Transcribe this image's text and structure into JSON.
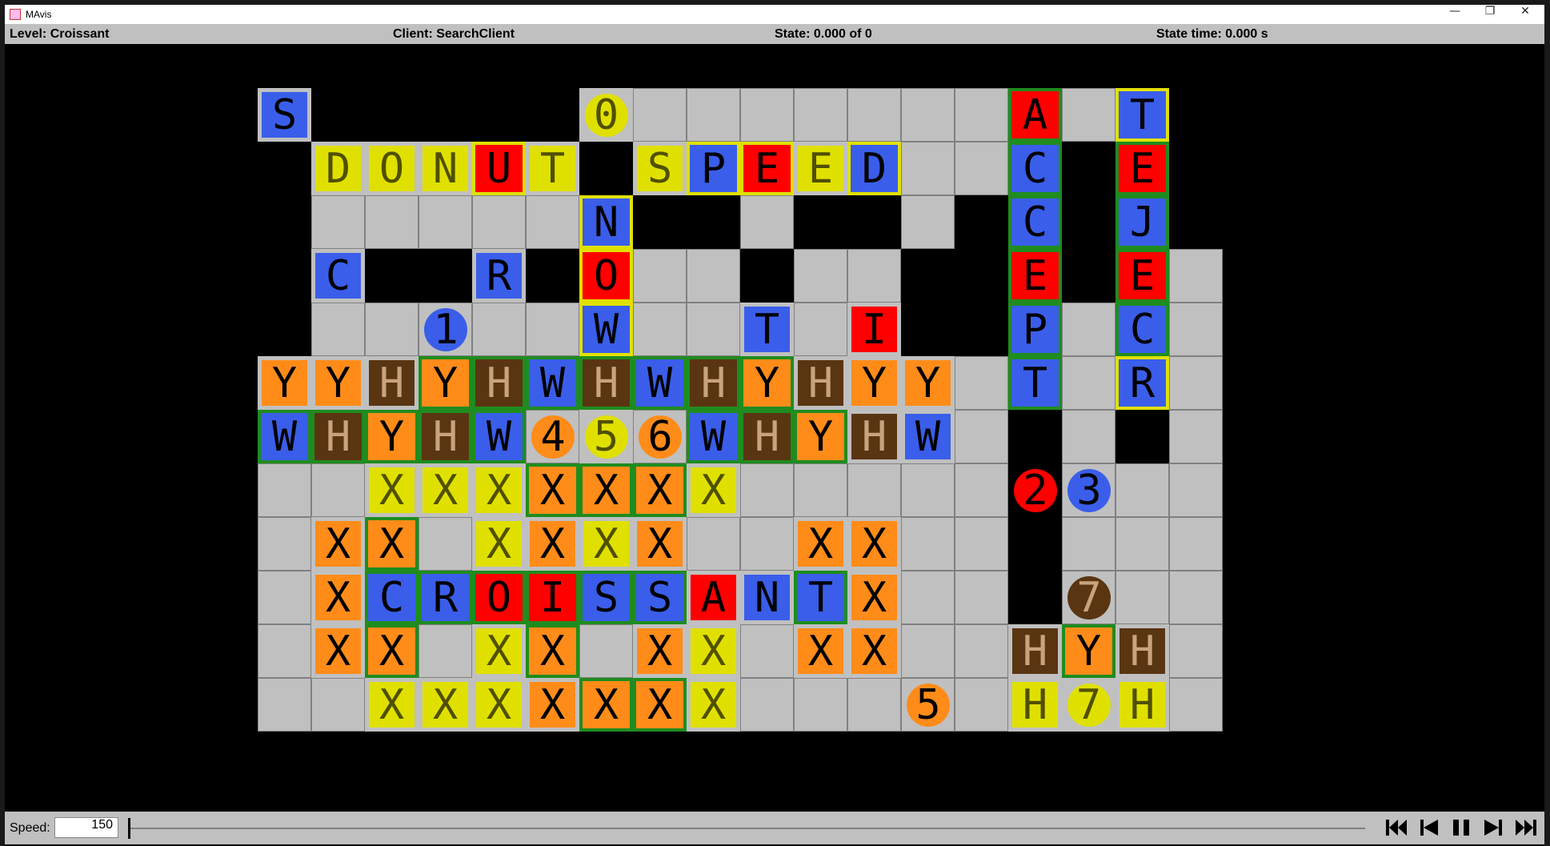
{
  "window": {
    "title": "MAvis",
    "minimize_icon": "minimize-icon",
    "maximize_icon": "restore-icon",
    "close_icon": "close-icon"
  },
  "status": {
    "level": "Level: Croissant",
    "client": "Client: SearchClient",
    "state": "State: 0.000 of 0",
    "state_time": "State time: 0.000 s"
  },
  "colors": {
    "yellow": "#e0e000",
    "yellow_text": "#505000",
    "red": "#ff0000",
    "blue": "#3a5eea",
    "orange": "#ff8c19",
    "brown": "#5a3512",
    "brown_text": "#c9a27e",
    "green": "#1f8c1f",
    "floor": "#c0c0c0",
    "wall": "#000000"
  },
  "board": {
    "floor_rows": [
      "#######..........#",
      "#.....#....#...#.#",
      "#.....###.##.#.#.#",
      "#.##.##..#..##.##.",
      "#..........####.#.",
      "..............#.#.",
      "..............#.#.",
      "..............#...",
      "..............#...",
      "..............#...",
      "..............#...",
      "..............#..."
    ],
    "goals": [
      {
        "letter": "0",
        "row": 0,
        "col": 6,
        "color": "yellow"
      },
      {
        "letter": "5",
        "row": 6,
        "col": 6,
        "color": "yellow"
      },
      {
        "letter": "7",
        "row": 11,
        "col": 15,
        "color": "yellow"
      }
    ],
    "boxes": [
      {
        "letter": "S",
        "row": 0,
        "col": 0,
        "color": "blue"
      },
      {
        "letter": "D",
        "row": 1,
        "col": 1,
        "color": "yellow"
      },
      {
        "letter": "O",
        "row": 1,
        "col": 2,
        "color": "yellow"
      },
      {
        "letter": "N",
        "row": 1,
        "col": 3,
        "color": "yellow"
      },
      {
        "letter": "U",
        "row": 1,
        "col": 4,
        "color": "red",
        "on_goal": "yellow"
      },
      {
        "letter": "T",
        "row": 1,
        "col": 5,
        "color": "yellow"
      },
      {
        "letter": "S",
        "row": 1,
        "col": 7,
        "color": "yellow"
      },
      {
        "letter": "P",
        "row": 1,
        "col": 8,
        "color": "blue",
        "on_goal": "yellow"
      },
      {
        "letter": "E",
        "row": 1,
        "col": 9,
        "color": "red",
        "on_goal": "yellow"
      },
      {
        "letter": "E",
        "row": 1,
        "col": 10,
        "color": "yellow"
      },
      {
        "letter": "D",
        "row": 1,
        "col": 11,
        "color": "blue",
        "on_goal": "yellow"
      },
      {
        "letter": "N",
        "row": 2,
        "col": 6,
        "color": "blue",
        "on_goal": "yellow"
      },
      {
        "letter": "C",
        "row": 3,
        "col": 1,
        "color": "blue"
      },
      {
        "letter": "R",
        "row": 3,
        "col": 4,
        "color": "blue"
      },
      {
        "letter": "O",
        "row": 3,
        "col": 6,
        "color": "red",
        "on_goal": "yellow"
      },
      {
        "letter": "W",
        "row": 4,
        "col": 6,
        "color": "blue",
        "on_goal": "yellow"
      },
      {
        "letter": "T",
        "row": 4,
        "col": 9,
        "color": "blue"
      },
      {
        "letter": "I",
        "row": 4,
        "col": 11,
        "color": "red"
      },
      {
        "letter": "Y",
        "row": 5,
        "col": 0,
        "color": "orange"
      },
      {
        "letter": "Y",
        "row": 5,
        "col": 1,
        "color": "orange"
      },
      {
        "letter": "H",
        "row": 5,
        "col": 2,
        "color": "brown"
      },
      {
        "letter": "Y",
        "row": 5,
        "col": 3,
        "color": "orange",
        "on_goal": "green"
      },
      {
        "letter": "H",
        "row": 5,
        "col": 4,
        "color": "brown",
        "on_goal": "green"
      },
      {
        "letter": "W",
        "row": 5,
        "col": 5,
        "color": "blue",
        "on_goal": "green"
      },
      {
        "letter": "H",
        "row": 5,
        "col": 6,
        "color": "brown",
        "on_goal": "green"
      },
      {
        "letter": "W",
        "row": 5,
        "col": 7,
        "color": "blue",
        "on_goal": "green"
      },
      {
        "letter": "H",
        "row": 5,
        "col": 8,
        "color": "brown",
        "on_goal": "green"
      },
      {
        "letter": "Y",
        "row": 5,
        "col": 9,
        "color": "orange",
        "on_goal": "green"
      },
      {
        "letter": "H",
        "row": 5,
        "col": 10,
        "color": "brown"
      },
      {
        "letter": "Y",
        "row": 5,
        "col": 11,
        "color": "orange"
      },
      {
        "letter": "Y",
        "row": 5,
        "col": 12,
        "color": "orange"
      },
      {
        "letter": "W",
        "row": 6,
        "col": 0,
        "color": "blue",
        "on_goal": "green"
      },
      {
        "letter": "H",
        "row": 6,
        "col": 1,
        "color": "brown",
        "on_goal": "green"
      },
      {
        "letter": "Y",
        "row": 6,
        "col": 2,
        "color": "orange",
        "on_goal": "green"
      },
      {
        "letter": "H",
        "row": 6,
        "col": 3,
        "color": "brown",
        "on_goal": "green"
      },
      {
        "letter": "W",
        "row": 6,
        "col": 4,
        "color": "blue",
        "on_goal": "green"
      },
      {
        "letter": "W",
        "row": 6,
        "col": 8,
        "color": "blue",
        "on_goal": "green"
      },
      {
        "letter": "H",
        "row": 6,
        "col": 9,
        "color": "brown",
        "on_goal": "green"
      },
      {
        "letter": "Y",
        "row": 6,
        "col": 10,
        "color": "orange",
        "on_goal": "green"
      },
      {
        "letter": "H",
        "row": 6,
        "col": 11,
        "color": "brown"
      },
      {
        "letter": "W",
        "row": 6,
        "col": 12,
        "color": "blue"
      },
      {
        "letter": "X",
        "row": 7,
        "col": 2,
        "color": "yellow"
      },
      {
        "letter": "X",
        "row": 7,
        "col": 3,
        "color": "yellow"
      },
      {
        "letter": "X",
        "row": 7,
        "col": 4,
        "color": "yellow"
      },
      {
        "letter": "X",
        "row": 7,
        "col": 5,
        "color": "orange",
        "on_goal": "green"
      },
      {
        "letter": "X",
        "row": 7,
        "col": 6,
        "color": "orange",
        "on_goal": "green"
      },
      {
        "letter": "X",
        "row": 7,
        "col": 7,
        "color": "orange",
        "on_goal": "green"
      },
      {
        "letter": "X",
        "row": 7,
        "col": 8,
        "color": "yellow"
      },
      {
        "letter": "X",
        "row": 8,
        "col": 1,
        "color": "orange"
      },
      {
        "letter": "X",
        "row": 8,
        "col": 2,
        "color": "orange",
        "on_goal": "green"
      },
      {
        "letter": "X",
        "row": 8,
        "col": 4,
        "color": "yellow"
      },
      {
        "letter": "X",
        "row": 8,
        "col": 5,
        "color": "orange"
      },
      {
        "letter": "X",
        "row": 8,
        "col": 6,
        "color": "yellow"
      },
      {
        "letter": "X",
        "row": 8,
        "col": 7,
        "color": "orange"
      },
      {
        "letter": "X",
        "row": 8,
        "col": 10,
        "color": "orange"
      },
      {
        "letter": "X",
        "row": 8,
        "col": 11,
        "color": "orange"
      },
      {
        "letter": "X",
        "row": 9,
        "col": 1,
        "color": "orange"
      },
      {
        "letter": "C",
        "row": 9,
        "col": 2,
        "color": "blue",
        "on_goal": "green"
      },
      {
        "letter": "R",
        "row": 9,
        "col": 3,
        "color": "blue",
        "on_goal": "green"
      },
      {
        "letter": "O",
        "row": 9,
        "col": 4,
        "color": "red",
        "on_goal": "green"
      },
      {
        "letter": "I",
        "row": 9,
        "col": 5,
        "color": "red",
        "on_goal": "green"
      },
      {
        "letter": "S",
        "row": 9,
        "col": 6,
        "color": "blue",
        "on_goal": "green"
      },
      {
        "letter": "S",
        "row": 9,
        "col": 7,
        "color": "blue",
        "on_goal": "green"
      },
      {
        "letter": "A",
        "row": 9,
        "col": 8,
        "color": "red"
      },
      {
        "letter": "N",
        "row": 9,
        "col": 9,
        "color": "blue"
      },
      {
        "letter": "T",
        "row": 9,
        "col": 10,
        "color": "blue",
        "on_goal": "green"
      },
      {
        "letter": "X",
        "row": 9,
        "col": 11,
        "color": "orange"
      },
      {
        "letter": "X",
        "row": 10,
        "col": 1,
        "color": "orange"
      },
      {
        "letter": "X",
        "row": 10,
        "col": 2,
        "color": "orange",
        "on_goal": "green"
      },
      {
        "letter": "X",
        "row": 10,
        "col": 4,
        "color": "yellow"
      },
      {
        "letter": "X",
        "row": 10,
        "col": 5,
        "color": "orange",
        "on_goal": "green"
      },
      {
        "letter": "X",
        "row": 10,
        "col": 7,
        "color": "orange"
      },
      {
        "letter": "X",
        "row": 10,
        "col": 8,
        "color": "yellow"
      },
      {
        "letter": "X",
        "row": 10,
        "col": 10,
        "color": "orange"
      },
      {
        "letter": "X",
        "row": 10,
        "col": 11,
        "color": "orange"
      },
      {
        "letter": "X",
        "row": 11,
        "col": 2,
        "color": "yellow"
      },
      {
        "letter": "X",
        "row": 11,
        "col": 3,
        "color": "yellow"
      },
      {
        "letter": "X",
        "row": 11,
        "col": 4,
        "color": "yellow"
      },
      {
        "letter": "X",
        "row": 11,
        "col": 5,
        "color": "orange"
      },
      {
        "letter": "X",
        "row": 11,
        "col": 6,
        "color": "orange",
        "on_goal": "green"
      },
      {
        "letter": "X",
        "row": 11,
        "col": 7,
        "color": "orange",
        "on_goal": "green"
      },
      {
        "letter": "X",
        "row": 11,
        "col": 8,
        "color": "yellow"
      },
      {
        "letter": "A",
        "row": 0,
        "col": 14,
        "color": "red",
        "on_goal": "green"
      },
      {
        "letter": "C",
        "row": 1,
        "col": 14,
        "color": "blue",
        "on_goal": "green"
      },
      {
        "letter": "C",
        "row": 2,
        "col": 14,
        "color": "blue",
        "on_goal": "green"
      },
      {
        "letter": "E",
        "row": 3,
        "col": 14,
        "color": "red",
        "on_goal": "green"
      },
      {
        "letter": "P",
        "row": 4,
        "col": 14,
        "color": "blue",
        "on_goal": "green"
      },
      {
        "letter": "T",
        "row": 5,
        "col": 14,
        "color": "blue",
        "on_goal": "green"
      },
      {
        "letter": "T",
        "row": 0,
        "col": 16,
        "color": "blue",
        "on_goal": "yellow"
      },
      {
        "letter": "E",
        "row": 1,
        "col": 16,
        "color": "red",
        "on_goal": "green"
      },
      {
        "letter": "J",
        "row": 2,
        "col": 16,
        "color": "blue",
        "on_goal": "green"
      },
      {
        "letter": "E",
        "row": 3,
        "col": 16,
        "color": "red",
        "on_goal": "green"
      },
      {
        "letter": "C",
        "row": 4,
        "col": 16,
        "color": "blue",
        "on_goal": "green"
      },
      {
        "letter": "R",
        "row": 5,
        "col": 16,
        "color": "blue",
        "on_goal": "yellow"
      },
      {
        "letter": "H",
        "row": 10,
        "col": 14,
        "color": "brown"
      },
      {
        "letter": "Y",
        "row": 10,
        "col": 15,
        "color": "orange",
        "on_goal": "green"
      },
      {
        "letter": "H",
        "row": 10,
        "col": 16,
        "color": "brown"
      },
      {
        "letter": "H",
        "row": 11,
        "col": 14,
        "color": "yellow"
      },
      {
        "letter": "H",
        "row": 11,
        "col": 16,
        "color": "yellow"
      }
    ],
    "agents": [
      {
        "label": "1",
        "row": 4,
        "col": 3,
        "color": "blue"
      },
      {
        "label": "4",
        "row": 6,
        "col": 5,
        "color": "orange"
      },
      {
        "label": "6",
        "row": 6,
        "col": 7,
        "color": "orange"
      },
      {
        "label": "5",
        "row": 11,
        "col": 12,
        "color": "orange"
      },
      {
        "label": "2",
        "row": 7,
        "col": 14,
        "color": "red"
      },
      {
        "label": "3",
        "row": 7,
        "col": 15,
        "color": "blue"
      },
      {
        "label": "7",
        "row": 9,
        "col": 15,
        "color": "brown"
      }
    ]
  },
  "controls": {
    "speed_label": "Speed:",
    "speed_value": "150",
    "timeline_progress": 0,
    "buttons": [
      {
        "name": "skip-to-start-button",
        "icon": "skip-back-icon"
      },
      {
        "name": "step-back-button",
        "icon": "step-back-icon"
      },
      {
        "name": "pause-button",
        "icon": "pause-icon"
      },
      {
        "name": "step-forward-button",
        "icon": "step-forward-icon"
      },
      {
        "name": "skip-to-end-button",
        "icon": "skip-forward-icon"
      }
    ]
  }
}
